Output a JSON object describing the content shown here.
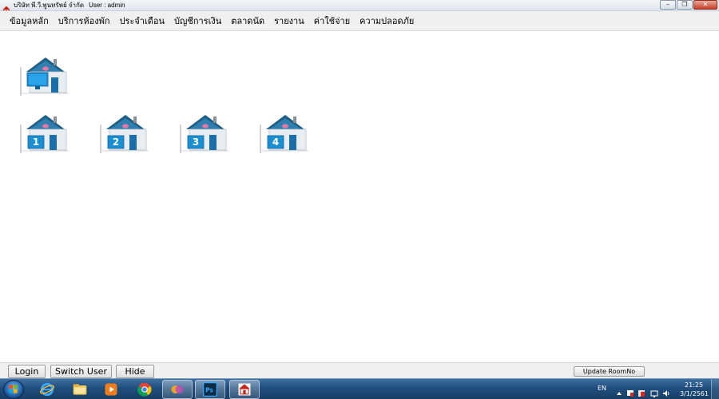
{
  "window": {
    "company": "บริษัท พี.วี.พูนทรัพย์ จำกัด",
    "user_label": "User : admin"
  },
  "menu": [
    "ข้อมูลหลัก",
    "บริการห้องพัก",
    "ประจำเดือน",
    "บัญชีการเงิน",
    "ตลาดนัด",
    "รายงาน",
    "ค่าใช้จ่าย",
    "ความปลอดภัย"
  ],
  "buildings": {
    "numbered": [
      "1",
      "2",
      "3",
      "4"
    ]
  },
  "bottom_bar": {
    "login": "Login",
    "switch_user": "Switch User",
    "hide": "Hide",
    "update_room": "Update RoomNo"
  },
  "taskbar": {
    "language": "EN",
    "time": "21:25",
    "date": "3/1/2561"
  },
  "colors": {
    "house_roof": "#1f5f86",
    "house_wall": "#e8edf2",
    "house_plate": "#1b8fd3",
    "taskbar": "#1f4e7c"
  }
}
